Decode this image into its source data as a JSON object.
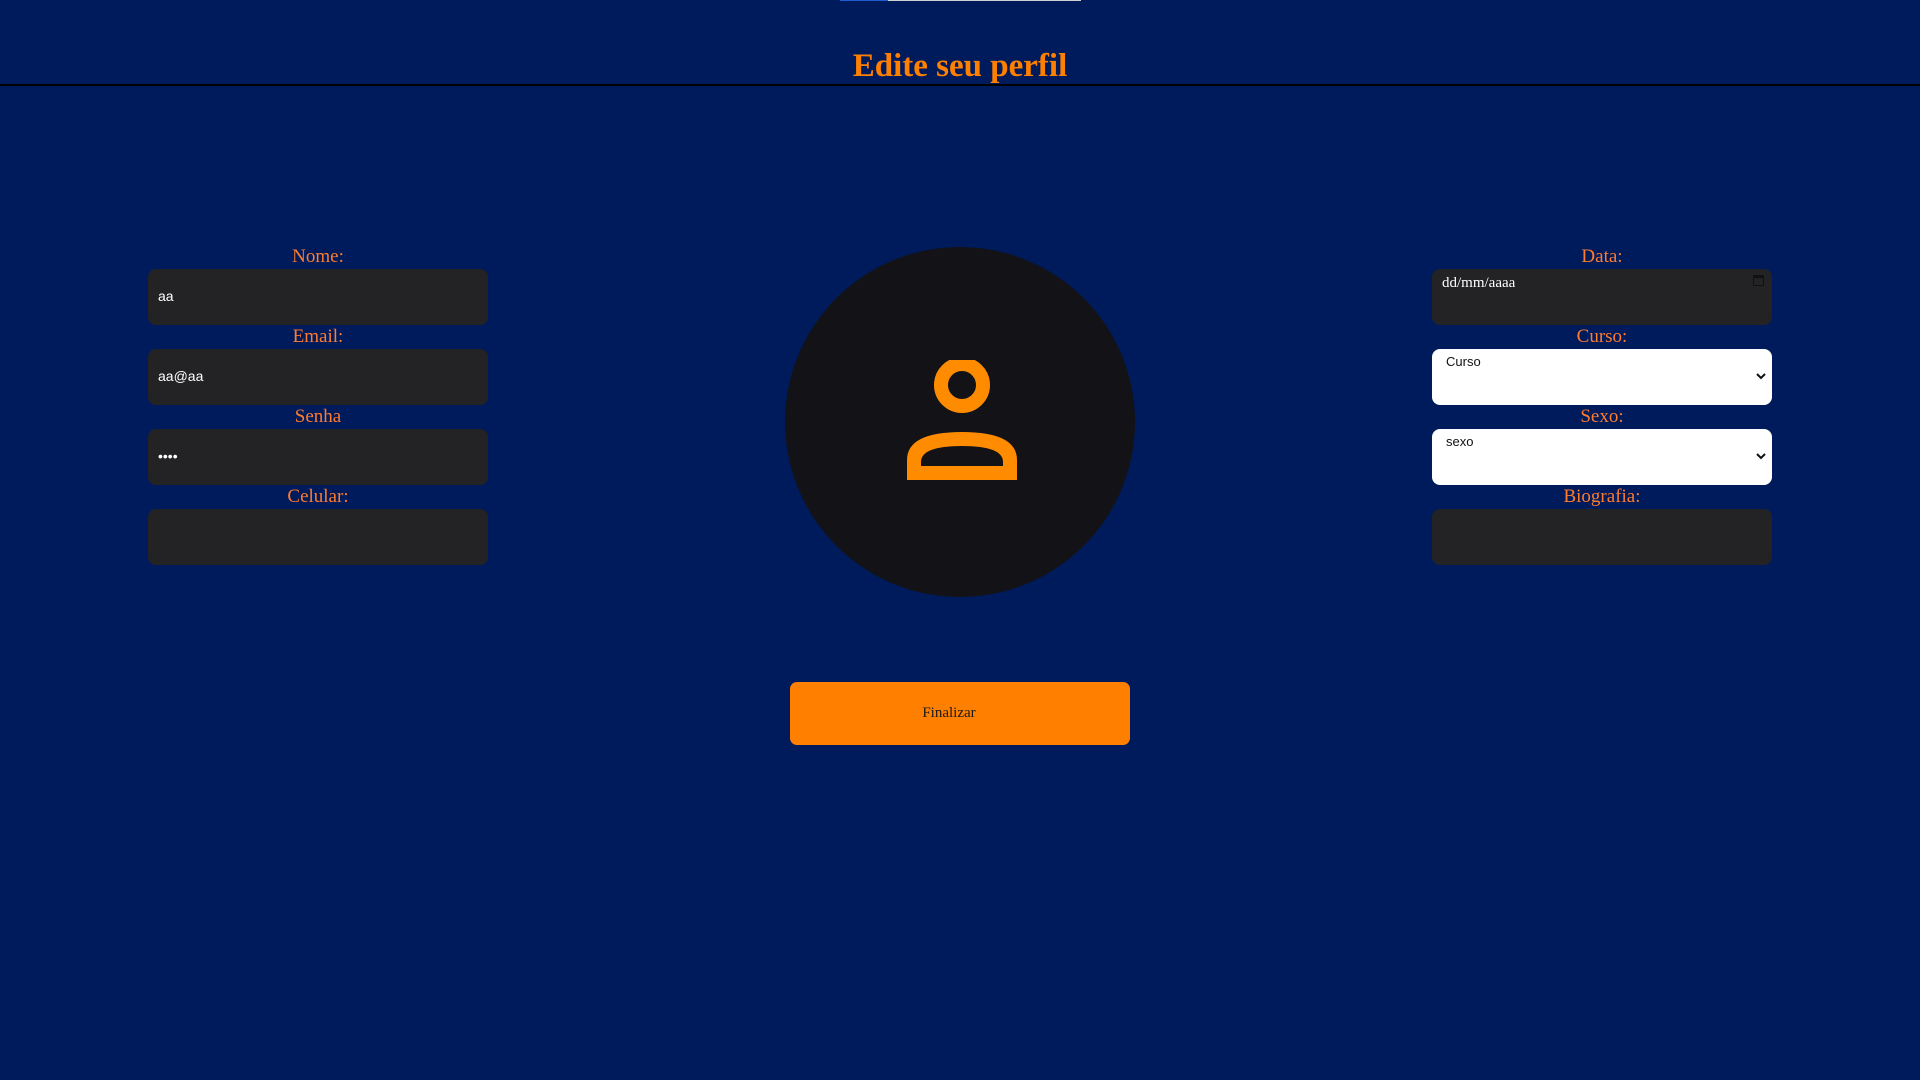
{
  "header": {
    "title": "Edite seu perfil"
  },
  "left_form": {
    "name": {
      "label": "Nome:",
      "value": "aa"
    },
    "email": {
      "label": "Email:",
      "value": "aa@aa"
    },
    "password": {
      "label": "Senha",
      "value": "••••"
    },
    "phone": {
      "label": "Celular:",
      "value": ""
    }
  },
  "right_form": {
    "date": {
      "label": "Data:",
      "placeholder": "dd/mm/aaaa"
    },
    "course": {
      "label": "Curso:",
      "selected": "Curso"
    },
    "sex": {
      "label": "Sexo:",
      "selected": "sexo"
    },
    "bio": {
      "label": "Biografia:",
      "value": ""
    }
  },
  "avatar": {
    "icon": "user-profile-icon"
  },
  "actions": {
    "finish_label": "Finalizar"
  },
  "colors": {
    "background": "#001b5c",
    "accent": "#ff8000",
    "label": "#ff7b2e",
    "input_bg": "#232326",
    "avatar_bg": "#121217"
  }
}
